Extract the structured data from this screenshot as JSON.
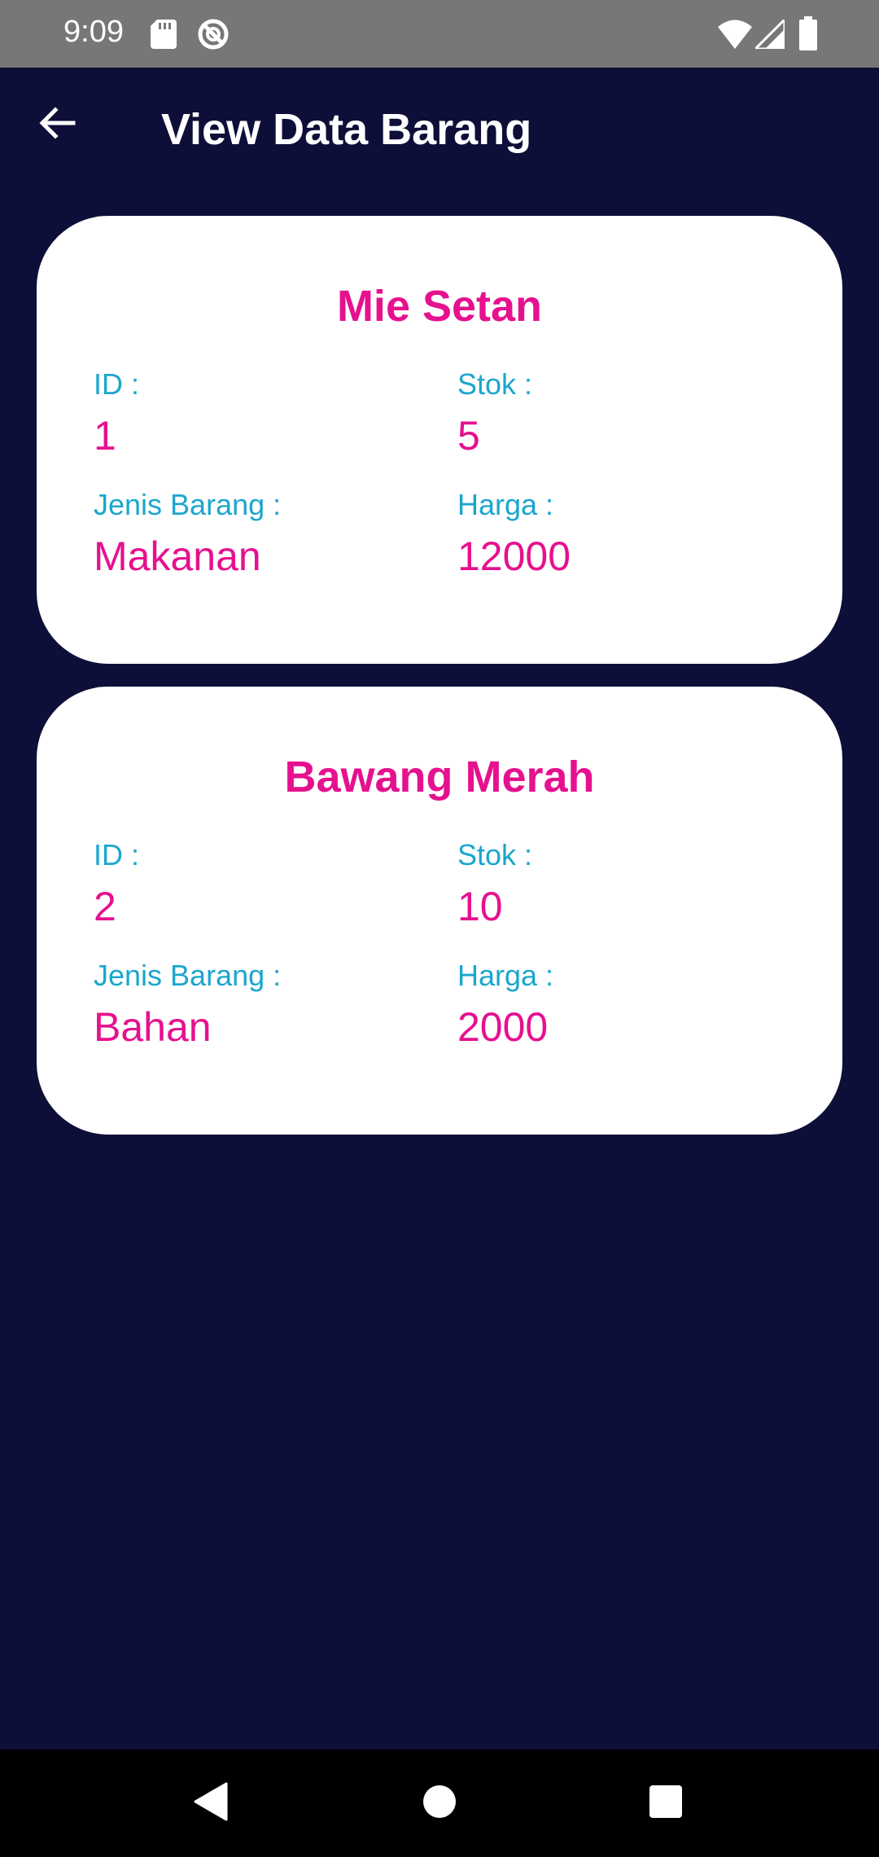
{
  "status_bar": {
    "time": "9:09",
    "icons_left": [
      "sd-card-icon",
      "do-not-disturb-icon"
    ],
    "icons_right": [
      "wifi-icon",
      "cellular-signal-icon",
      "battery-icon"
    ]
  },
  "app_bar": {
    "back_icon": "arrow-left-icon",
    "title": "View Data Barang"
  },
  "colors": {
    "background": "#0e0f38",
    "card": "#ffffff",
    "accent_pink": "#e6118f",
    "label_blue": "#1ba6cd",
    "status_bar": "#777777"
  },
  "items": [
    {
      "name": "Mie Setan",
      "id_label": "ID :",
      "id": "1",
      "stok_label": "Stok :",
      "stok": "5",
      "jenis_label": "Jenis Barang :",
      "jenis": "Makanan",
      "harga_label": "Harga :",
      "harga": "12000"
    },
    {
      "name": "Bawang Merah",
      "id_label": "ID :",
      "id": "2",
      "stok_label": "Stok :",
      "stok": "10",
      "jenis_label": "Jenis Barang :",
      "jenis": "Bahan",
      "harga_label": "Harga :",
      "harga": "2000"
    }
  ],
  "nav_bar": {
    "buttons": [
      "back-triangle-icon",
      "home-circle-icon",
      "recents-square-icon"
    ]
  }
}
